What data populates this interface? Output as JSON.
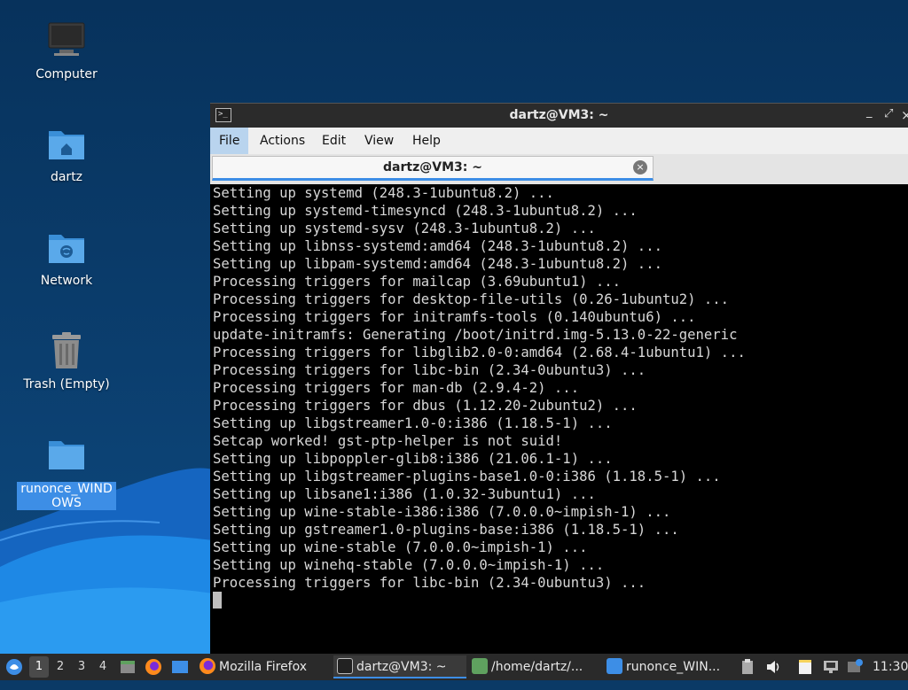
{
  "desktop": {
    "icons": [
      {
        "label": "Computer"
      },
      {
        "label": "dartz"
      },
      {
        "label": "Network"
      },
      {
        "label": "Trash (Empty)"
      },
      {
        "label": "runonce_WINDOWS"
      }
    ]
  },
  "window": {
    "title": "dartz@VM3: ~",
    "controls": {
      "minimize": "_",
      "maximize": "⤢",
      "close": "×"
    },
    "menu": [
      "File",
      "Actions",
      "Edit",
      "View",
      "Help"
    ],
    "tab": {
      "title": "dartz@VM3: ~",
      "close": "×"
    }
  },
  "terminal": {
    "lines": [
      "Setting up systemd (248.3-1ubuntu8.2) ...",
      "Setting up systemd-timesyncd (248.3-1ubuntu8.2) ...",
      "Setting up systemd-sysv (248.3-1ubuntu8.2) ...",
      "Setting up libnss-systemd:amd64 (248.3-1ubuntu8.2) ...",
      "Setting up libpam-systemd:amd64 (248.3-1ubuntu8.2) ...",
      "Processing triggers for mailcap (3.69ubuntu1) ...",
      "Processing triggers for desktop-file-utils (0.26-1ubuntu2) ...",
      "Processing triggers for initramfs-tools (0.140ubuntu6) ...",
      "update-initramfs: Generating /boot/initrd.img-5.13.0-22-generic",
      "Processing triggers for libglib2.0-0:amd64 (2.68.4-1ubuntu1) ...",
      "Processing triggers for libc-bin (2.34-0ubuntu3) ...",
      "Processing triggers for man-db (2.9.4-2) ...",
      "Processing triggers for dbus (1.12.20-2ubuntu2) ...",
      "Setting up libgstreamer1.0-0:i386 (1.18.5-1) ...",
      "Setcap worked! gst-ptp-helper is not suid!",
      "Setting up libpoppler-glib8:i386 (21.06.1-1) ...",
      "Setting up libgstreamer-plugins-base1.0-0:i386 (1.18.5-1) ...",
      "Setting up libsane1:i386 (1.0.32-3ubuntu1) ...",
      "Setting up wine-stable-i386:i386 (7.0.0.0~impish-1) ...",
      "Setting up gstreamer1.0-plugins-base:i386 (1.18.5-1) ...",
      "Setting up wine-stable (7.0.0.0~impish-1) ...",
      "Setting up winehq-stable (7.0.0.0~impish-1) ...",
      "Processing triggers for libc-bin (2.34-0ubuntu3) ..."
    ]
  },
  "taskbar": {
    "workspaces": [
      "1",
      "2",
      "3",
      "4"
    ],
    "tasks": [
      {
        "label": "Mozilla Firefox"
      },
      {
        "label": "dartz@VM3: ~"
      },
      {
        "label": "/home/dartz/..."
      },
      {
        "label": "runonce_WIN..."
      }
    ],
    "clock": "11:30"
  },
  "colors": {
    "accent": "#3d8ee6",
    "terminal_bg": "#000000",
    "desktop_bg": "#0b3a66"
  }
}
